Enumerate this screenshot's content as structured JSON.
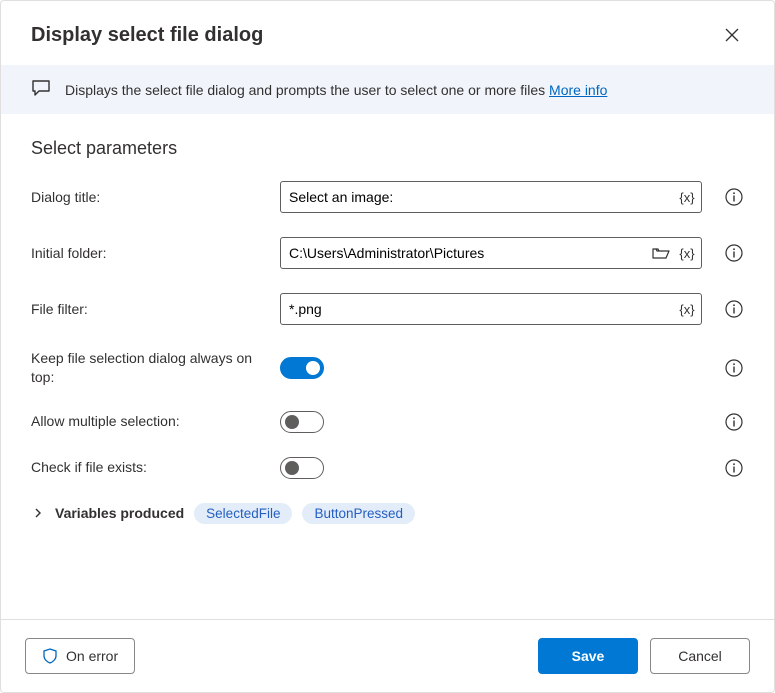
{
  "header": {
    "title": "Display select file dialog"
  },
  "banner": {
    "text": "Displays the select file dialog and prompts the user to select one or more files ",
    "link": "More info"
  },
  "section": {
    "title": "Select parameters"
  },
  "fields": {
    "dialog_title": {
      "label": "Dialog title:",
      "value": "Select an image:"
    },
    "initial_folder": {
      "label": "Initial folder:",
      "value": "C:\\Users\\Administrator\\Pictures"
    },
    "file_filter": {
      "label": "File filter:",
      "value": "*.png"
    },
    "always_on_top": {
      "label": "Keep file selection dialog always on top:"
    },
    "allow_multiple": {
      "label": "Allow multiple selection:"
    },
    "check_exists": {
      "label": "Check if file exists:"
    }
  },
  "variables": {
    "label": "Variables produced",
    "chips": [
      "SelectedFile",
      "ButtonPressed"
    ]
  },
  "footer": {
    "on_error": "On error",
    "save": "Save",
    "cancel": "Cancel"
  },
  "toggles": {
    "always_on_top": true,
    "allow_multiple": false,
    "check_exists": false
  }
}
